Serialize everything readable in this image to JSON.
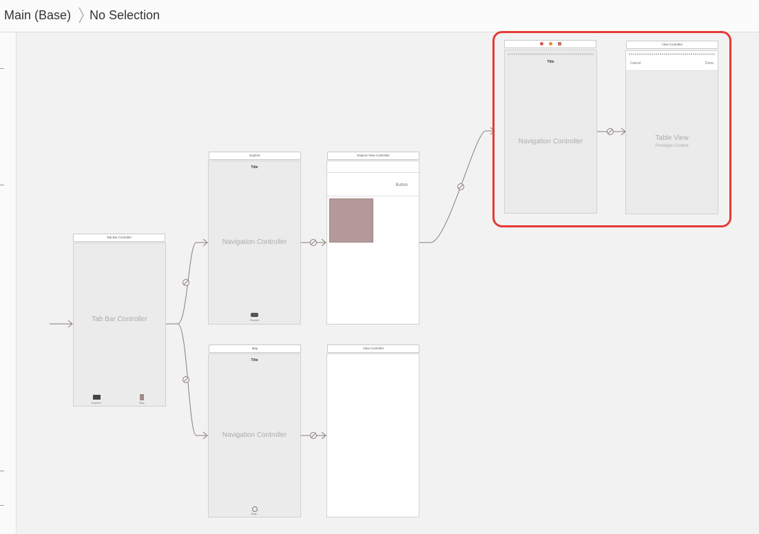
{
  "breadcrumb": {
    "file": "Main (Base)",
    "selection": "No Selection"
  },
  "scenes": {
    "tabbar": {
      "header": "Tab Bar Controller",
      "label": "Tab Bar Controller",
      "tab1": "Explore",
      "tab2": "Map"
    },
    "nav_explore": {
      "header": "Explore",
      "title": "Title",
      "label": "Navigation Controller",
      "tab_item": "Explore"
    },
    "explore_vc": {
      "header": "Explore View Controller",
      "button": "Button"
    },
    "nav_map": {
      "header": "Map",
      "title": "Title",
      "label": "Navigation Controller",
      "tab_item": "Map"
    },
    "map_vc": {
      "header": "View Controller"
    },
    "nav_modal": {
      "title": "Title",
      "label": "Navigation Controller"
    },
    "table_vc": {
      "header": "View Controller",
      "cancel": "Cancel",
      "done": "Done",
      "label": "Table View",
      "sublabel": "Prototype Content"
    }
  },
  "colors": {
    "highlight": "#e53935",
    "segue": "#8a7a7a",
    "image": "#b39a98"
  }
}
